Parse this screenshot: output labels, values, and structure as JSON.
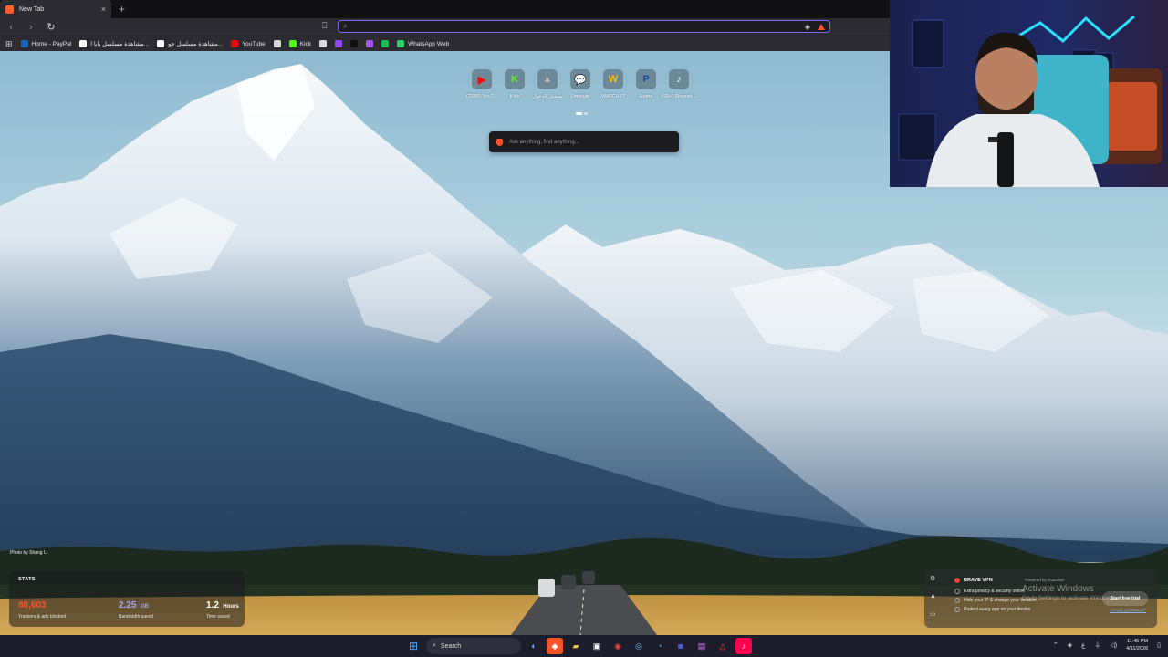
{
  "browser": {
    "tab": {
      "title": "New Tab",
      "close": "×"
    },
    "new_tab": "+",
    "toolbar": {
      "back": "‹",
      "forward": "›",
      "reload": "↻"
    },
    "address": {
      "value": "",
      "placeholder": ""
    }
  },
  "bookmarks": [
    {
      "label": "Home - PayPal",
      "color": "#1565c0"
    },
    {
      "label": "مشاهدة مسلسل بابا ا...",
      "color": "#ffffff"
    },
    {
      "label": "مشاهدة مسلسل جو...",
      "color": "#ffffff"
    },
    {
      "label": "YouTube",
      "color": "#ff0000"
    },
    {
      "label": "",
      "color": "#d9d9d9"
    },
    {
      "label": "Kick",
      "color": "#53fc18"
    },
    {
      "label": "",
      "color": "#d9d9d9"
    },
    {
      "label": "",
      "color": "#9147ff"
    },
    {
      "label": "",
      "color": "#111111"
    },
    {
      "label": "",
      "color": "#a855f7"
    },
    {
      "label": "",
      "color": "#1db954"
    },
    {
      "label": "WhatsApp Web",
      "color": "#25d366"
    }
  ],
  "top_sites": [
    {
      "label": "(2238) YouT...",
      "icon": "youtube-icon",
      "glyph": "▶",
      "color": "#ff0000"
    },
    {
      "label": "Kick",
      "icon": "kick-icon",
      "glyph": "K",
      "color": "#53fc18"
    },
    {
      "label": "تسجيل الدخول",
      "icon": "tent-icon",
      "glyph": "▲",
      "color": "#bbbbbb"
    },
    {
      "label": "Umingle",
      "icon": "chat-icon",
      "glyph": "💬",
      "color": "#8b5cf6"
    },
    {
      "label": "WATCH IT",
      "icon": "watchit-icon",
      "glyph": "W",
      "color": "#f4c20d"
    },
    {
      "label": "Home",
      "icon": "paypal-icon",
      "glyph": "P",
      "color": "#1a4ba8"
    },
    {
      "label": "(99+) Sheesh...",
      "icon": "tiktok-icon",
      "glyph": "♪",
      "color": "#ffffff"
    }
  ],
  "ask": {
    "placeholder": "Ask anything, find anything..."
  },
  "stats": {
    "heading": "STATS",
    "trackers": {
      "value": "80,603",
      "label": "Trackers & ads blocked",
      "color": "#fb542b"
    },
    "bandwidth": {
      "value": "2.25",
      "unit": "GB",
      "label": "Bandwidth saved",
      "color": "#a0a6ff"
    },
    "time": {
      "value": "1.2",
      "unit": "Hours",
      "label": "Time saved",
      "color": "#ffffff"
    }
  },
  "photo_credit": "Photo by Shang Li",
  "vpn": {
    "brand": "BRAVE VPN",
    "powered": "Powered by Guardian",
    "features": [
      "Extra privacy & security online",
      "Hide your IP & change your location",
      "Protect every app on your device"
    ],
    "cta": "Start free trial",
    "purchased": "Already purchased?"
  },
  "watermark": {
    "line1": "Activate Windows",
    "line2": "Go to Settings to activate Windows."
  },
  "taskbar": {
    "search": "Search",
    "time": "11:45 PM",
    "date": "4/11/2026",
    "lang": "ع"
  }
}
